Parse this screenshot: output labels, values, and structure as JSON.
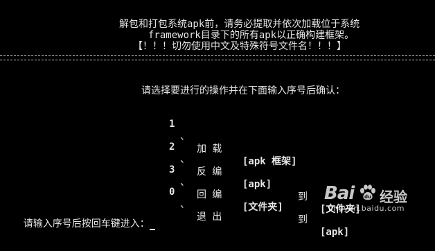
{
  "header": {
    "line1": "解包和打包系统apk前，请务必提取并依次加载位于系统",
    "line2": "framework目录下的所有apk以正确构建框架。",
    "line3": "【！！！切勿使用中文及特殊符号文件名！！！】"
  },
  "menu": {
    "instruction": "请选择要进行的操作并在下面输入序号后确认：",
    "items": [
      {
        "num": "1",
        "sep": "、",
        "action": "加 载",
        "arg1": "[apk 框架]",
        "to": "",
        "arg2": ""
      },
      {
        "num": "2",
        "sep": "、",
        "action": "反 编",
        "arg1": "[apk]",
        "to": "到",
        "arg2": "[文件夹]"
      },
      {
        "num": "3",
        "sep": "、",
        "action": "回 编",
        "arg1": "[文件夹]",
        "to": "到",
        "arg2": "[apk]"
      },
      {
        "num": "0",
        "sep": "、",
        "action": "退 出",
        "arg1": "",
        "to": "",
        "arg2": ""
      }
    ]
  },
  "prompt": {
    "text": "请输入序号后按回车键进入："
  },
  "watermark": {
    "logo_text": "Bai",
    "paw_icon": "baidu-paw-icon",
    "brand": "经验",
    "url": "jingyan.baidu.com"
  }
}
